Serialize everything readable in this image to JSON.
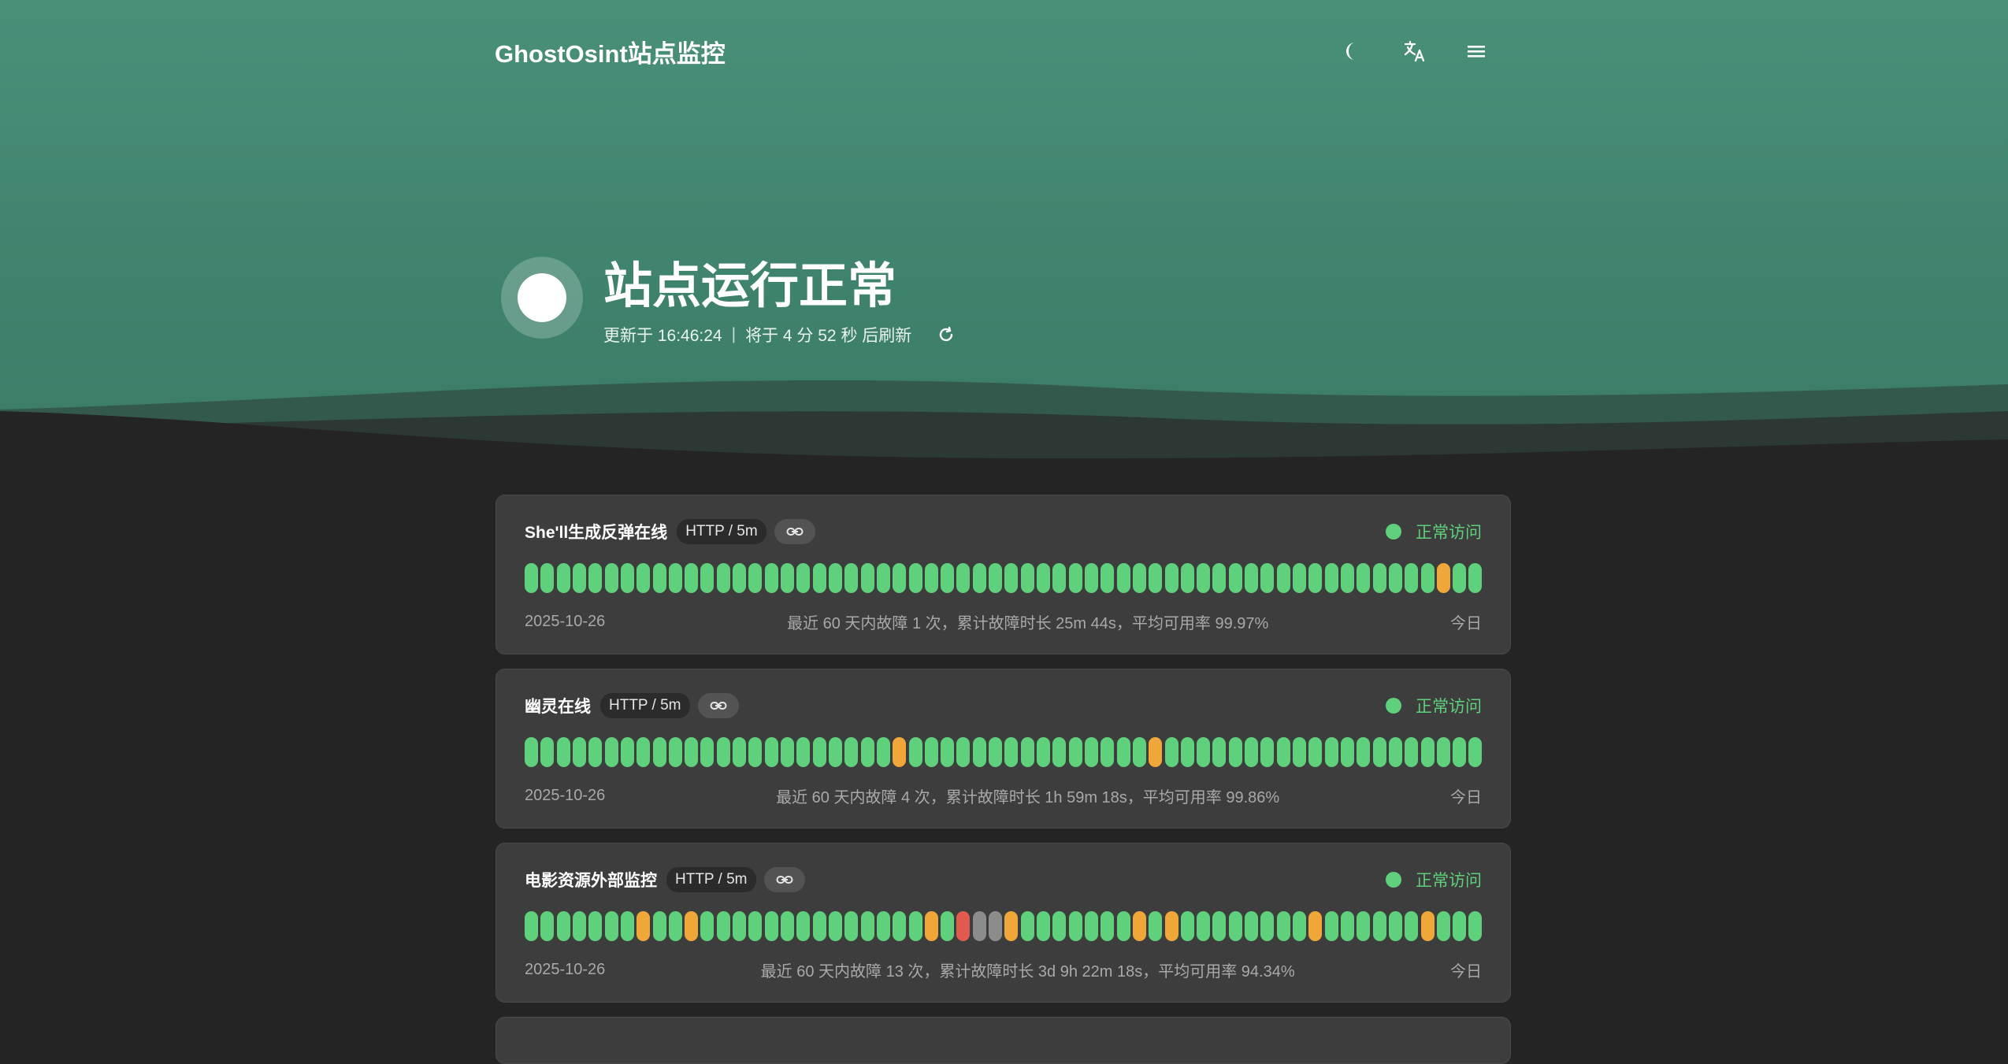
{
  "app": {
    "title": "GhostOsint站点监控"
  },
  "nav": {
    "icons": [
      "moon-icon",
      "translate-icon",
      "menu-icon"
    ]
  },
  "status": {
    "title": "站点运行正常",
    "updated": "更新于 16:46:24",
    "separator": "|",
    "next_refresh": "将于 4 分 52 秒 后刷新"
  },
  "colors": {
    "ok": "#5fd07b",
    "warn": "#f0a73a",
    "error": "#e15b50",
    "unknown": "#8c8c8c",
    "hero": "#418570"
  },
  "monitors": [
    {
      "name": "She'll生成反弹在线",
      "tag": "HTTP / 5m",
      "status_label": "正常访问",
      "start_date": "2025-10-26",
      "summary": "最近 60 天内故障 1 次，累计故障时长 25m 44s，平均可用率 99.97%",
      "end_label": "今日",
      "days": [
        "ok",
        "ok",
        "ok",
        "ok",
        "ok",
        "ok",
        "ok",
        "ok",
        "ok",
        "ok",
        "ok",
        "ok",
        "ok",
        "ok",
        "ok",
        "ok",
        "ok",
        "ok",
        "ok",
        "ok",
        "ok",
        "ok",
        "ok",
        "ok",
        "ok",
        "ok",
        "ok",
        "ok",
        "ok",
        "ok",
        "ok",
        "ok",
        "ok",
        "ok",
        "ok",
        "ok",
        "ok",
        "ok",
        "ok",
        "ok",
        "ok",
        "ok",
        "ok",
        "ok",
        "ok",
        "ok",
        "ok",
        "ok",
        "ok",
        "ok",
        "ok",
        "ok",
        "ok",
        "ok",
        "ok",
        "ok",
        "ok",
        "warn",
        "ok",
        "ok"
      ]
    },
    {
      "name": "幽灵在线",
      "tag": "HTTP / 5m",
      "status_label": "正常访问",
      "start_date": "2025-10-26",
      "summary": "最近 60 天内故障 4 次，累计故障时长 1h 59m 18s，平均可用率 99.86%",
      "end_label": "今日",
      "days": [
        "ok",
        "ok",
        "ok",
        "ok",
        "ok",
        "ok",
        "ok",
        "ok",
        "ok",
        "ok",
        "ok",
        "ok",
        "ok",
        "ok",
        "ok",
        "ok",
        "ok",
        "ok",
        "ok",
        "ok",
        "ok",
        "ok",
        "ok",
        "warn",
        "ok",
        "ok",
        "ok",
        "ok",
        "ok",
        "ok",
        "ok",
        "ok",
        "ok",
        "ok",
        "ok",
        "ok",
        "ok",
        "ok",
        "ok",
        "warn",
        "ok",
        "ok",
        "ok",
        "ok",
        "ok",
        "ok",
        "ok",
        "ok",
        "ok",
        "ok",
        "ok",
        "ok",
        "ok",
        "ok",
        "ok",
        "ok",
        "ok",
        "ok",
        "ok",
        "ok"
      ]
    },
    {
      "name": "电影资源外部监控",
      "tag": "HTTP / 5m",
      "status_label": "正常访问",
      "start_date": "2025-10-26",
      "summary": "最近 60 天内故障 13 次，累计故障时长 3d 9h 22m 18s，平均可用率 94.34%",
      "end_label": "今日",
      "days": [
        "ok",
        "ok",
        "ok",
        "ok",
        "ok",
        "ok",
        "ok",
        "warn",
        "ok",
        "ok",
        "warn",
        "ok",
        "ok",
        "ok",
        "ok",
        "ok",
        "ok",
        "ok",
        "ok",
        "ok",
        "ok",
        "ok",
        "ok",
        "ok",
        "ok",
        "warn",
        "ok",
        "err",
        "gray",
        "gray",
        "warn",
        "ok",
        "ok",
        "ok",
        "ok",
        "ok",
        "ok",
        "ok",
        "warn",
        "ok",
        "warn",
        "ok",
        "ok",
        "ok",
        "ok",
        "ok",
        "ok",
        "ok",
        "ok",
        "warn",
        "ok",
        "ok",
        "ok",
        "ok",
        "ok",
        "ok",
        "warn",
        "ok",
        "ok",
        "ok"
      ]
    }
  ]
}
